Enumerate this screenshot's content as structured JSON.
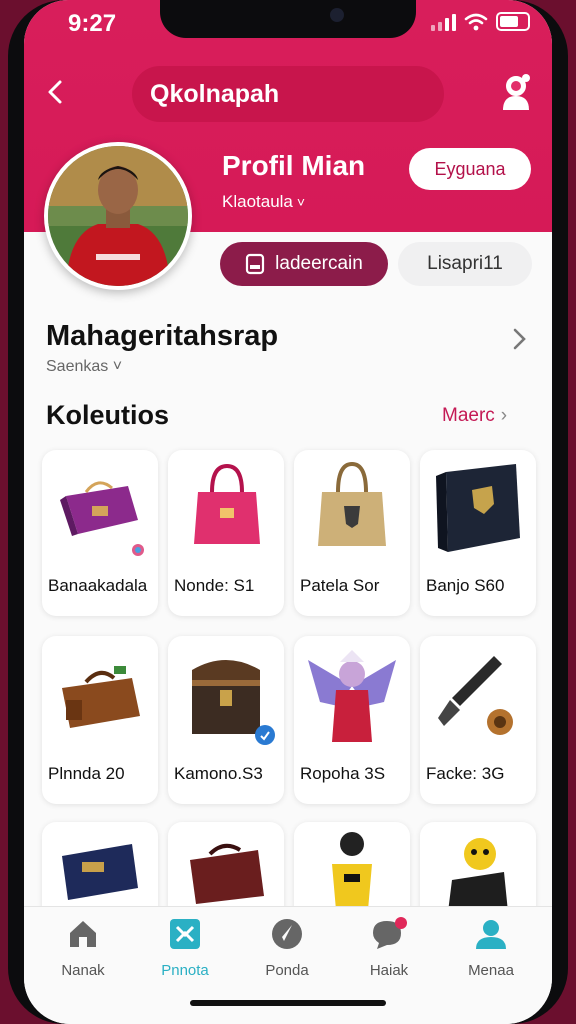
{
  "status_bar": {
    "time": "9:27"
  },
  "header": {
    "search_text": "Qkolnapah"
  },
  "profile": {
    "name": "Profil Mian",
    "subtitle": "Klaotaula",
    "action_button": "Eyguana"
  },
  "tabs": [
    {
      "label": "ladeercain",
      "active": true
    },
    {
      "label": "Lisapri11",
      "active": false
    }
  ],
  "section": {
    "title": "Mahageritahsrap",
    "subtitle": "Saenkas"
  },
  "collection": {
    "title": "Koleutios",
    "more_label": "Maerc",
    "items": [
      {
        "label": "Banaakadala",
        "icon": "purple-bag-icon"
      },
      {
        "label": "Nonde: S1",
        "icon": "pink-handbag-icon"
      },
      {
        "label": "Patela Sor",
        "icon": "canvas-bag-icon"
      },
      {
        "label": "Banjo S60",
        "icon": "dark-wallet-icon"
      },
      {
        "label": "Plnnda 20",
        "icon": "brown-duffel-icon"
      },
      {
        "label": "Kamono.S3",
        "icon": "chest-icon"
      },
      {
        "label": "Ropoha 3S",
        "icon": "winged-jersey-icon"
      },
      {
        "label": "Facke: 3G",
        "icon": "tool-icon"
      },
      {
        "label": "",
        "icon": "navy-case-icon"
      },
      {
        "label": "",
        "icon": "red-bag-icon"
      },
      {
        "label": "",
        "icon": "player-figure-icon"
      },
      {
        "label": "",
        "icon": "mascot-figure-icon"
      }
    ]
  },
  "bottom_nav": [
    {
      "label": "Nanak",
      "icon": "home-icon",
      "active": false
    },
    {
      "label": "Pnnota",
      "icon": "collection-icon",
      "active": true
    },
    {
      "label": "Ponda",
      "icon": "compass-icon",
      "active": false
    },
    {
      "label": "Haiak",
      "icon": "chat-icon",
      "active": false
    },
    {
      "label": "Menaa",
      "icon": "profile-icon",
      "active": false
    }
  ],
  "colors": {
    "brand": "#d81e5b",
    "active_nav": "#2bb0c4",
    "tab_active": "#8c1c4a"
  }
}
